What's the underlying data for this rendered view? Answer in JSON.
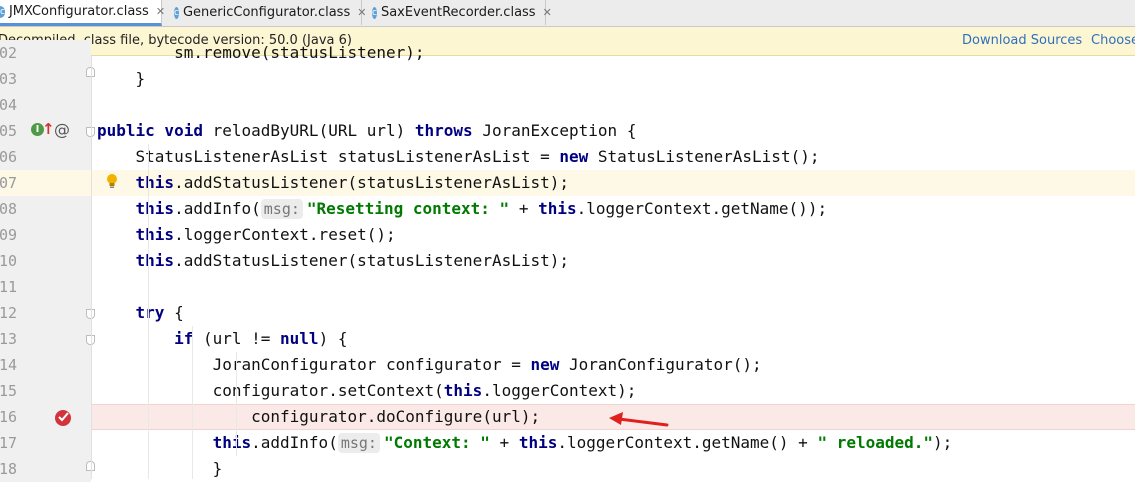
{
  "tabs": [
    {
      "label": "JMXConfigurator.class",
      "active": true
    },
    {
      "label": "GenericConfigurator.class",
      "active": false
    },
    {
      "label": "SaxEventRecorder.class",
      "active": false
    }
  ],
  "notification": {
    "message": "Decompiled .class file, bytecode version: 50.0 (Java 6)",
    "download_sources": "Download Sources",
    "choose_sources": "Choose"
  },
  "lines": [
    {
      "num": "02",
      "code": "        sm.remove(statusListener);"
    },
    {
      "num": "03",
      "code": "    }"
    },
    {
      "num": "04",
      "code": ""
    },
    {
      "num": "05",
      "code": "    public void reloadByURL(URL url) throws JoranException {"
    },
    {
      "num": "06",
      "code": "        StatusListenerAsList statusListenerAsList = new StatusListenerAsList();"
    },
    {
      "num": "07",
      "code": "        this.addStatusListener(statusListenerAsList);"
    },
    {
      "num": "08",
      "code": "        this.addInfo( msg: \"Resetting context: \" + this.loggerContext.getName());"
    },
    {
      "num": "09",
      "code": "        this.loggerContext.reset();"
    },
    {
      "num": "10",
      "code": "        this.addStatusListener(statusListenerAsList);"
    },
    {
      "num": "11",
      "code": ""
    },
    {
      "num": "12",
      "code": "        try {"
    },
    {
      "num": "13",
      "code": "            if (url != null) {"
    },
    {
      "num": "14",
      "code": "                JoranConfigurator configurator = new JoranConfigurator();"
    },
    {
      "num": "15",
      "code": "                configurator.setContext(this.loggerContext);"
    },
    {
      "num": "16",
      "code": "                configurator.doConfigure(url);"
    },
    {
      "num": "17",
      "code": "                this.addInfo( msg: \"Context: \" + this.loggerContext.getName() + \" reloaded.\");"
    },
    {
      "num": "18",
      "code": "            }"
    }
  ],
  "colors": {
    "keyword": "#000080",
    "string": "#007a00",
    "caret_row": "#fdf9e6",
    "breakpoint_row": "#fbe9e7",
    "breakpoint": "#d1343c",
    "arrow": "#e0201b",
    "link": "#2f6fbf"
  }
}
